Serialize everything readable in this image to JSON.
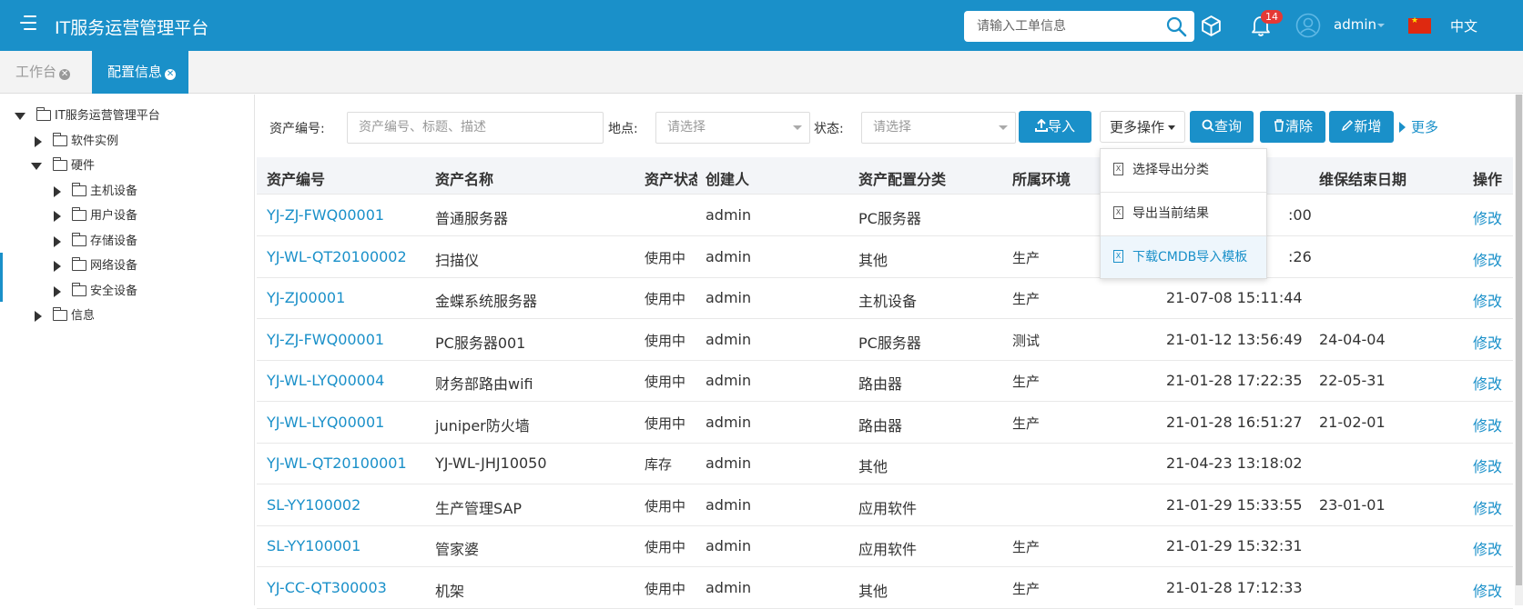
{
  "header": {
    "title": "IT服务运营管理平台",
    "search_placeholder": "请输入工单信息",
    "notification_count": "14",
    "user": "admin",
    "language": "中文"
  },
  "tabs": [
    {
      "label": "工作台"
    },
    {
      "label": "配置信息"
    }
  ],
  "tree": {
    "root": "IT服务运营管理平台",
    "software": "软件实例",
    "hardware": "硬件",
    "host": "主机设备",
    "user_dev": "用户设备",
    "storage": "存储设备",
    "network": "网络设备",
    "security": "安全设备",
    "info": "信息"
  },
  "filters": {
    "asset_no_label": "资产编号:",
    "asset_no_placeholder": "资产编号、标题、描述",
    "location_label": "地点:",
    "location_placeholder": "请选择",
    "status_label": "状态:",
    "status_placeholder": "请选择"
  },
  "toolbar": {
    "import": "导入",
    "more_ops": "更多操作",
    "query": "查询",
    "clear": "清除",
    "add": "新增",
    "more": "更多"
  },
  "dropdown": {
    "items": [
      "选择导出分类",
      "导出当前结果",
      "下载CMDB导入模板"
    ]
  },
  "table": {
    "headers": [
      "资产编号",
      "资产名称",
      "资产状态",
      "创建人",
      "资产配置分类",
      "所属环境",
      "维保结束日期",
      "操作"
    ],
    "rows": [
      {
        "no": "YJ-ZJ-FWQ00001",
        "name": "普通服务器",
        "status": "",
        "creator": "admin",
        "category": "PC服务器",
        "env": "",
        "created": ":00",
        "warranty": "",
        "op": "修改 "
      },
      {
        "no": "YJ-WL-QT20100002",
        "name": "扫描仪",
        "status": "使用中",
        "creator": "admin",
        "category": "其他",
        "env": "生产",
        "created": ":26",
        "warranty": "",
        "op": "修改 "
      },
      {
        "no": "YJ-ZJ00001",
        "name": "金蝶系统服务器",
        "status": "使用中",
        "creator": "admin",
        "category": "主机设备",
        "env": "生产",
        "created": "21-07-08 15:11:44",
        "warranty": "",
        "op": "修改 "
      },
      {
        "no": "YJ-ZJ-FWQ00001",
        "name": "PC服务器001",
        "status": "使用中",
        "creator": "admin",
        "category": "PC服务器",
        "env": "测试",
        "created": "21-01-12 13:56:49",
        "warranty": "24-04-04",
        "op": "修改 "
      },
      {
        "no": "YJ-WL-LYQ00004",
        "name": "财务部路由wifi",
        "status": "使用中",
        "creator": "admin",
        "category": "路由器",
        "env": "生产",
        "created": "21-01-28 17:22:35",
        "warranty": "22-05-31",
        "op": "修改 "
      },
      {
        "no": "YJ-WL-LYQ00001",
        "name": "juniper防火墙",
        "status": "使用中",
        "creator": "admin",
        "category": "路由器",
        "env": "生产",
        "created": "21-01-28 16:51:27",
        "warranty": "21-02-01",
        "op": "修改 "
      },
      {
        "no": "YJ-WL-QT20100001",
        "name": "YJ-WL-JHJ10050",
        "status": "库存",
        "creator": "admin",
        "category": "其他",
        "env": "",
        "created": "21-04-23 13:18:02",
        "warranty": "",
        "op": "修改 "
      },
      {
        "no": "SL-YY100002",
        "name": "生产管理SAP",
        "status": "使用中",
        "creator": "admin",
        "category": "应用软件",
        "env": "",
        "created": "21-01-29 15:33:55",
        "warranty": "23-01-01",
        "op": "修改 "
      },
      {
        "no": "SL-YY100001",
        "name": "管家婆",
        "status": "使用中",
        "creator": "admin",
        "category": "应用软件",
        "env": "生产",
        "created": "21-01-29 15:32:31",
        "warranty": "",
        "op": "修改 "
      },
      {
        "no": "YJ-CC-QT300003",
        "name": "机架",
        "status": "使用中",
        "creator": "admin",
        "category": "其他",
        "env": "生产",
        "created": "21-01-28 17:12:33",
        "warranty": "",
        "op": "修改 "
      }
    ]
  },
  "colors": {
    "primary": "#1a90c9",
    "badge": "#e53935"
  }
}
